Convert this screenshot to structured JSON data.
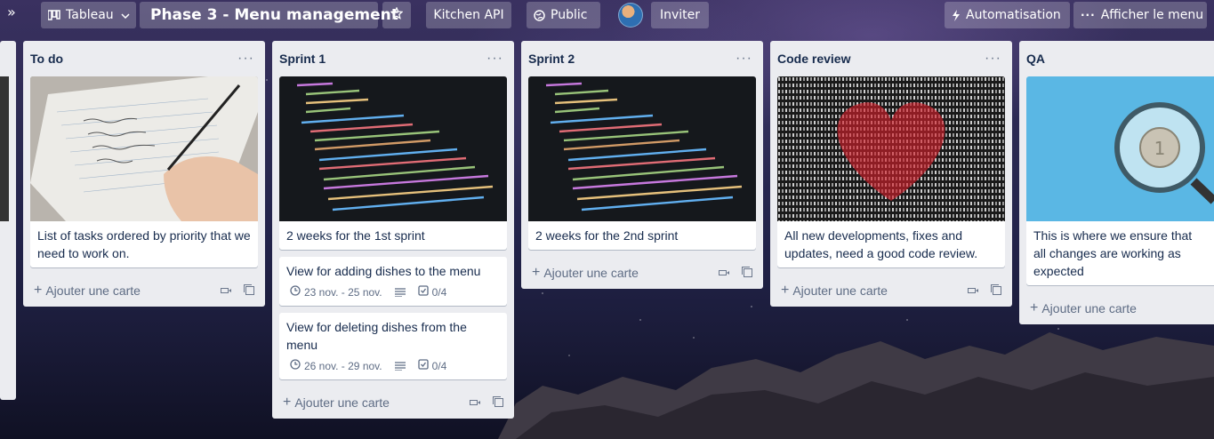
{
  "header": {
    "collapse_icon": "double-chevron-right-icon",
    "view_switcher": {
      "label": "Tableau",
      "icon": "board-icon"
    },
    "board_title": "Phase 3 - Menu management",
    "star_icon": "star-icon",
    "workspace": "Kitchen API",
    "visibility": {
      "label": "Public",
      "icon": "globe-icon"
    },
    "invite": "Inviter",
    "automation": {
      "label": "Automatisation",
      "icon": "bolt-icon"
    },
    "menu": {
      "label": "Afficher le menu",
      "icon": "ellipsis-icon"
    }
  },
  "lists": [
    {
      "title": "To do",
      "cards": [
        {
          "cover": "notebook-writing",
          "text": "List of tasks ordered by priority that we need to work on."
        }
      ],
      "add_label": "Ajouter une carte"
    },
    {
      "title": "Sprint 1",
      "cards": [
        {
          "cover": "code-screen",
          "text": "2 weeks for the 1st sprint"
        },
        {
          "text": "View for adding dishes to the menu",
          "dates": "23 nov. - 25 nov.",
          "checklist": "0/4"
        },
        {
          "text": "View for deleting dishes from the menu",
          "dates": "26 nov. - 29 nov.",
          "checklist": "0/4"
        }
      ],
      "add_label": "Ajouter une carte"
    },
    {
      "title": "Sprint 2",
      "cards": [
        {
          "cover": "code-screen",
          "text": "2 weeks for the 2nd sprint"
        }
      ],
      "add_label": "Ajouter une carte"
    },
    {
      "title": "Code review",
      "cards": [
        {
          "cover": "binary-heart",
          "text": "All new developments, fixes and updates, need a good code review."
        }
      ],
      "add_label": "Ajouter une carte"
    },
    {
      "title": "QA",
      "cards": [
        {
          "cover": "magnifier-coin",
          "text": "This is where we ensure that all changes are working as expected"
        }
      ],
      "add_label": "Ajouter une carte"
    }
  ],
  "colors": {
    "list_bg": "#ebecf0",
    "text": "#172b4d",
    "muted": "#5e6c84"
  }
}
